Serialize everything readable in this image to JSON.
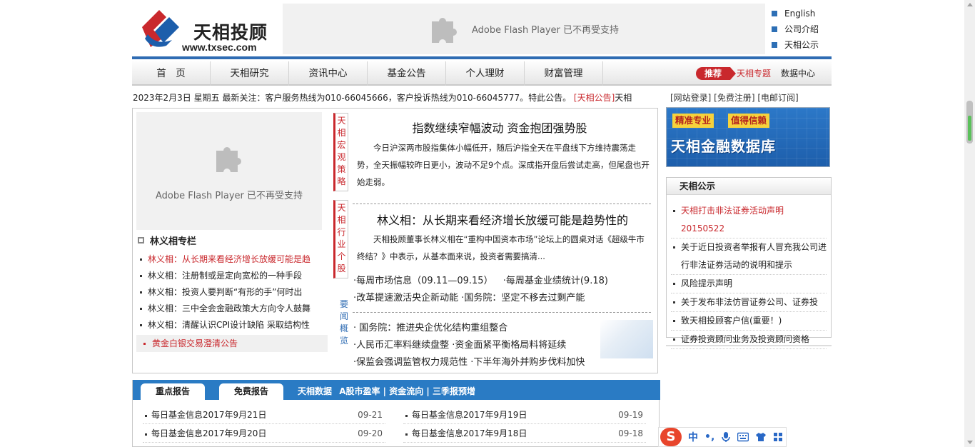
{
  "header": {
    "logo_cn": "天相投顾",
    "logo_url": "www.txsec.com",
    "flash_notice": "Adobe Flash Player 已不再受支持",
    "top_links": [
      "English",
      "公司介绍",
      "天相公示"
    ]
  },
  "nav": {
    "items": [
      "首　页",
      "天相研究",
      "资讯中心",
      "基金公告",
      "个人理财",
      "财富管理"
    ],
    "recommend_label": "推荐",
    "special": "天相专题",
    "data_center": "数据中心"
  },
  "notice": {
    "date": "2023年2月3日 星期五",
    "text": "最新关注：客户服务热线为010-66045666，客户投诉热线为010-66045777。特此公告。",
    "announcement": "[天相公告]",
    "tail": "天相"
  },
  "reg_links": "[网站登录] [免费注册] [电邮订阅]",
  "left": {
    "flash_notice": "Adobe Flash Player 已不再受支持",
    "column_title": "林义相专栏",
    "column_items": [
      "林义相：从长期来看经济增长放缓可能是趋",
      "林义相：注册制或是定向宽松的一种手段",
      "林义相：投资人要判断“有形的手”何时出",
      "林义相：三中全会金融政策大方向令人鼓舞",
      "林义相：清醒认识CPI设计缺陷 采取结构性"
    ],
    "gold_notice": "黄金白银交易澄清公告"
  },
  "tabs": {
    "macro": "天相宏观策略",
    "industry": "天相行业个股",
    "news": "要闻概览"
  },
  "center": {
    "headline1": "指数继续窄幅波动 资金抱团强势股",
    "para1": "今日沪深两市股指集体小幅低开，随后沪指全天在平盘线下方维持震荡走势，全天振幅较昨日更小，波动不足9个点。深成指开盘后尝试走高，但尾盘也开始走弱。",
    "headline2": "林义相：从长期来看经济增长放缓可能是趋势性的",
    "para2": "天相投顾董事长林义相在“重构中国资本市场”论坛上的圆桌对话《超级牛市终结？》中表示，从基本面来说，投资者需要搞清...",
    "links_a": [
      "·每周市场信息（09.11—09.15）",
      "·每周基金业绩统计(9.18)"
    ],
    "links_b": [
      "·改革提速激活央企新动能",
      "·国务院：坚定不移去过剩产能"
    ],
    "links_c": [
      "· 国务院：推进央企优化结构重组整合",
      "·人民币汇率料继续盘整",
      "·资金面紧平衡格局料将延续",
      "·保监会强调监管权力规范性",
      "·下半年海外并购步伐料加快"
    ]
  },
  "right": {
    "banner_tag1": "精准专业",
    "banner_tag2": "值得信赖",
    "banner_title": "天相金融数据库",
    "public_title": "天相公示",
    "public_items": [
      "天相打击非法证券活动声明20150522",
      "关于近日投资者举报有人冒充我公司进行非法证券活动的说明和提示",
      "风险提示声明",
      "关于发布非法仿冒证券公司、证券投",
      "致天相投顾客户信(重要！)",
      "证券投资顾问业务及投资顾问资格"
    ]
  },
  "report": {
    "tab1": "重点报告",
    "tab2": "免费报告",
    "extra_label": "天相数据",
    "extra_links": "A股市盈率 | 资金流向 | 三季报预增",
    "rows": [
      {
        "title": "每日基金信息2017年9月21日",
        "date": "09-21"
      },
      {
        "title": "每日基金信息2017年9月19日",
        "date": "09-19"
      },
      {
        "title": "每日基金信息2017年9月20日",
        "date": "09-20"
      },
      {
        "title": "每日基金信息2017年9月18日",
        "date": "09-18"
      }
    ]
  },
  "ime": {
    "logo": "S",
    "mode": "中",
    "punct": "•,"
  },
  "colors": {
    "brand_red": "#c9282d",
    "brand_blue": "#2f6cb3",
    "tab_blue": "#2a7bc4"
  }
}
